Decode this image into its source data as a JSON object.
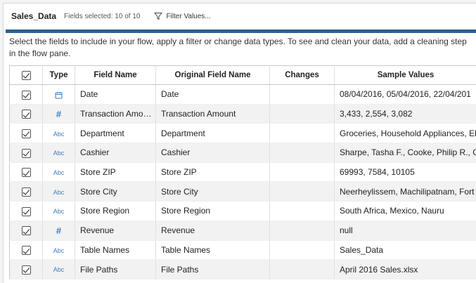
{
  "header": {
    "title": "Sales_Data",
    "fields_selected": "Fields selected: 10 of 10",
    "filter_label": "Filter Values..."
  },
  "accent_color": "#2c5f91",
  "description": "Select the fields to include in your flow, apply a filter or change data types. To see and clean your data, add a cleaning step in the flow pane.",
  "table": {
    "columns": [
      "Type",
      "Field Name",
      "Original Field Name",
      "Changes",
      "Sample Values"
    ],
    "rows": [
      {
        "type_icon": "calendar-icon",
        "type_glyph": "",
        "field_name": "Date",
        "original": "Date",
        "changes": "",
        "samples": "08/04/2016, 05/04/2016, 22/04/201"
      },
      {
        "type_icon": "number-icon",
        "type_glyph": "#",
        "field_name": "Transaction Amo…",
        "original": "Transaction Amount",
        "changes": "",
        "samples": "3,433, 2,554, 3,082"
      },
      {
        "type_icon": "string-icon",
        "type_glyph": "Abc",
        "field_name": "Department",
        "original": "Department",
        "changes": "",
        "samples": "Groceries, Household Appliances, Ele"
      },
      {
        "type_icon": "string-icon",
        "type_glyph": "Abc",
        "field_name": "Cashier",
        "original": "Cashier",
        "changes": "",
        "samples": "Sharpe, Tasha F., Cooke, Philip R., Gr"
      },
      {
        "type_icon": "string-icon",
        "type_glyph": "Abc",
        "field_name": "Store ZIP",
        "original": "Store ZIP",
        "changes": "",
        "samples": "69993, 7584, 10105"
      },
      {
        "type_icon": "string-icon",
        "type_glyph": "Abc",
        "field_name": "Store City",
        "original": "Store City",
        "changes": "",
        "samples": "Neerheylissem, Machilipatnam, Fort"
      },
      {
        "type_icon": "string-icon",
        "type_glyph": "Abc",
        "field_name": "Store Region",
        "original": "Store Region",
        "changes": "",
        "samples": "South Africa, Mexico, Nauru"
      },
      {
        "type_icon": "number-icon",
        "type_glyph": "#",
        "field_name": "Revenue",
        "original": "Revenue",
        "changes": "",
        "samples": "null"
      },
      {
        "type_icon": "string-icon",
        "type_glyph": "Abc",
        "field_name": "Table Names",
        "original": "Table Names",
        "changes": "",
        "samples": "Sales_Data"
      },
      {
        "type_icon": "string-icon",
        "type_glyph": "Abc",
        "field_name": "File Paths",
        "original": "File Paths",
        "changes": "",
        "samples": "April 2016 Sales.xlsx"
      }
    ]
  }
}
